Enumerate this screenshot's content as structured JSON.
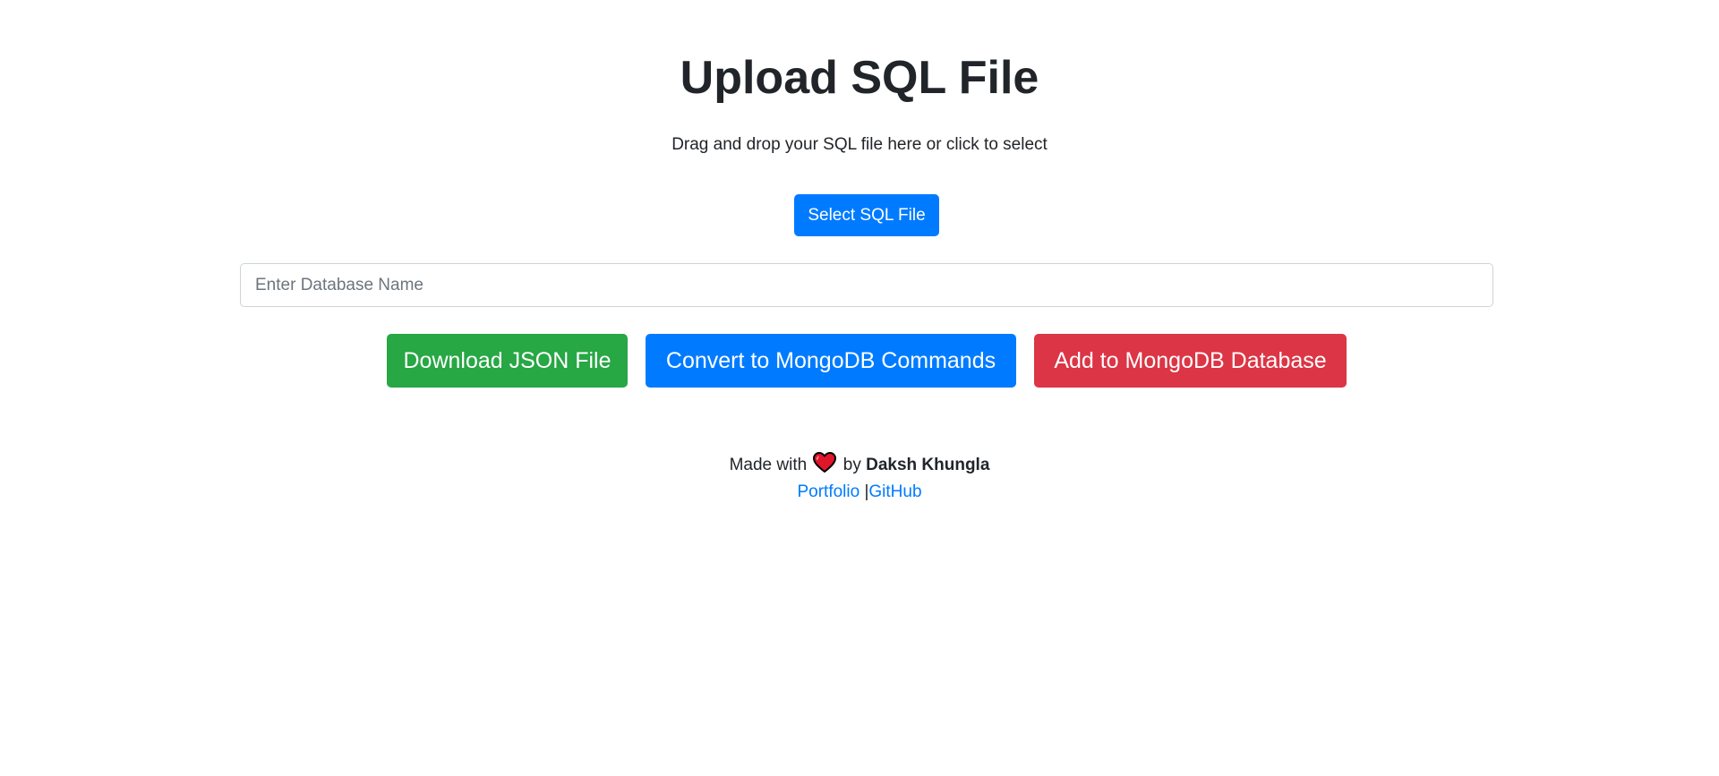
{
  "header": {
    "title": "Upload SQL File",
    "subtitle": "Drag and drop your SQL file here or click to select"
  },
  "upload": {
    "select_label": "Select SQL File"
  },
  "database": {
    "placeholder": "Enter Database Name",
    "value": ""
  },
  "actions": {
    "download_json": "Download JSON File",
    "convert_mongo": "Convert to MongoDB Commands",
    "add_mongo": "Add to MongoDB Database"
  },
  "footer": {
    "made_with": "Made with",
    "by": "by",
    "author": "Daksh Khungla",
    "portfolio": "Portfolio",
    "separator": "|",
    "github": "GitHub",
    "heart_icon": "heart-icon"
  },
  "colors": {
    "primary": "#007bff",
    "success": "#28a745",
    "danger": "#dc3545",
    "link": "#007bff",
    "text": "#212529"
  }
}
